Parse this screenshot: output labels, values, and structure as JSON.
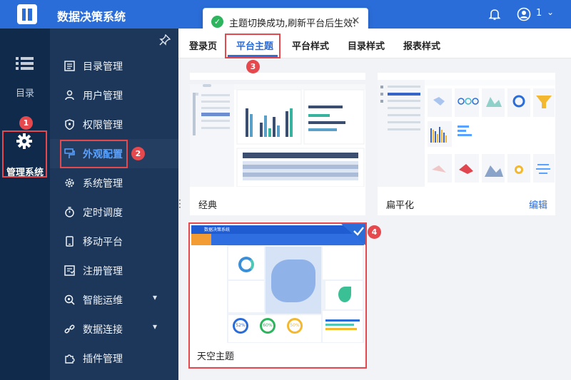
{
  "app": {
    "title": "数据决策系统",
    "user_name": "1"
  },
  "toast": {
    "message": "主题切换成功,刷新平台后生效!"
  },
  "rail": {
    "items": [
      {
        "label": "目录",
        "icon": "list-icon"
      },
      {
        "label": "管理系统",
        "icon": "gear-icon"
      }
    ]
  },
  "menu": {
    "items": [
      {
        "label": "目录管理",
        "icon": "catalog-icon"
      },
      {
        "label": "用户管理",
        "icon": "user-icon"
      },
      {
        "label": "权限管理",
        "icon": "shield-icon"
      },
      {
        "label": "外观配置",
        "icon": "appearance-icon",
        "active": true
      },
      {
        "label": "系统管理",
        "icon": "settings-icon"
      },
      {
        "label": "定时调度",
        "icon": "timer-icon"
      },
      {
        "label": "移动平台",
        "icon": "mobile-icon"
      },
      {
        "label": "注册管理",
        "icon": "register-icon"
      },
      {
        "label": "智能运维",
        "icon": "ops-icon",
        "expandable": true
      },
      {
        "label": "数据连接",
        "icon": "link-icon",
        "expandable": true
      },
      {
        "label": "插件管理",
        "icon": "plugin-icon"
      }
    ]
  },
  "tabs": [
    {
      "label": "登录页"
    },
    {
      "label": "平台主题",
      "active": true
    },
    {
      "label": "平台样式"
    },
    {
      "label": "目录样式"
    },
    {
      "label": "报表样式"
    }
  ],
  "themes": [
    {
      "name": "经典"
    },
    {
      "name": "扁平化",
      "edit_label": "编辑"
    },
    {
      "name": "天空主题",
      "selected": true
    }
  ],
  "sky_preview": {
    "header_title": "数据决策系统",
    "pct_1": "52%",
    "pct_2": "60%",
    "pct_3": "50%"
  },
  "badges": [
    "1",
    "2",
    "3",
    "4"
  ],
  "colors": {
    "brand": "#2a6dd9",
    "sidebar": "#1d375a",
    "rail": "#0f2a4b",
    "highlight": "#e5484d"
  }
}
